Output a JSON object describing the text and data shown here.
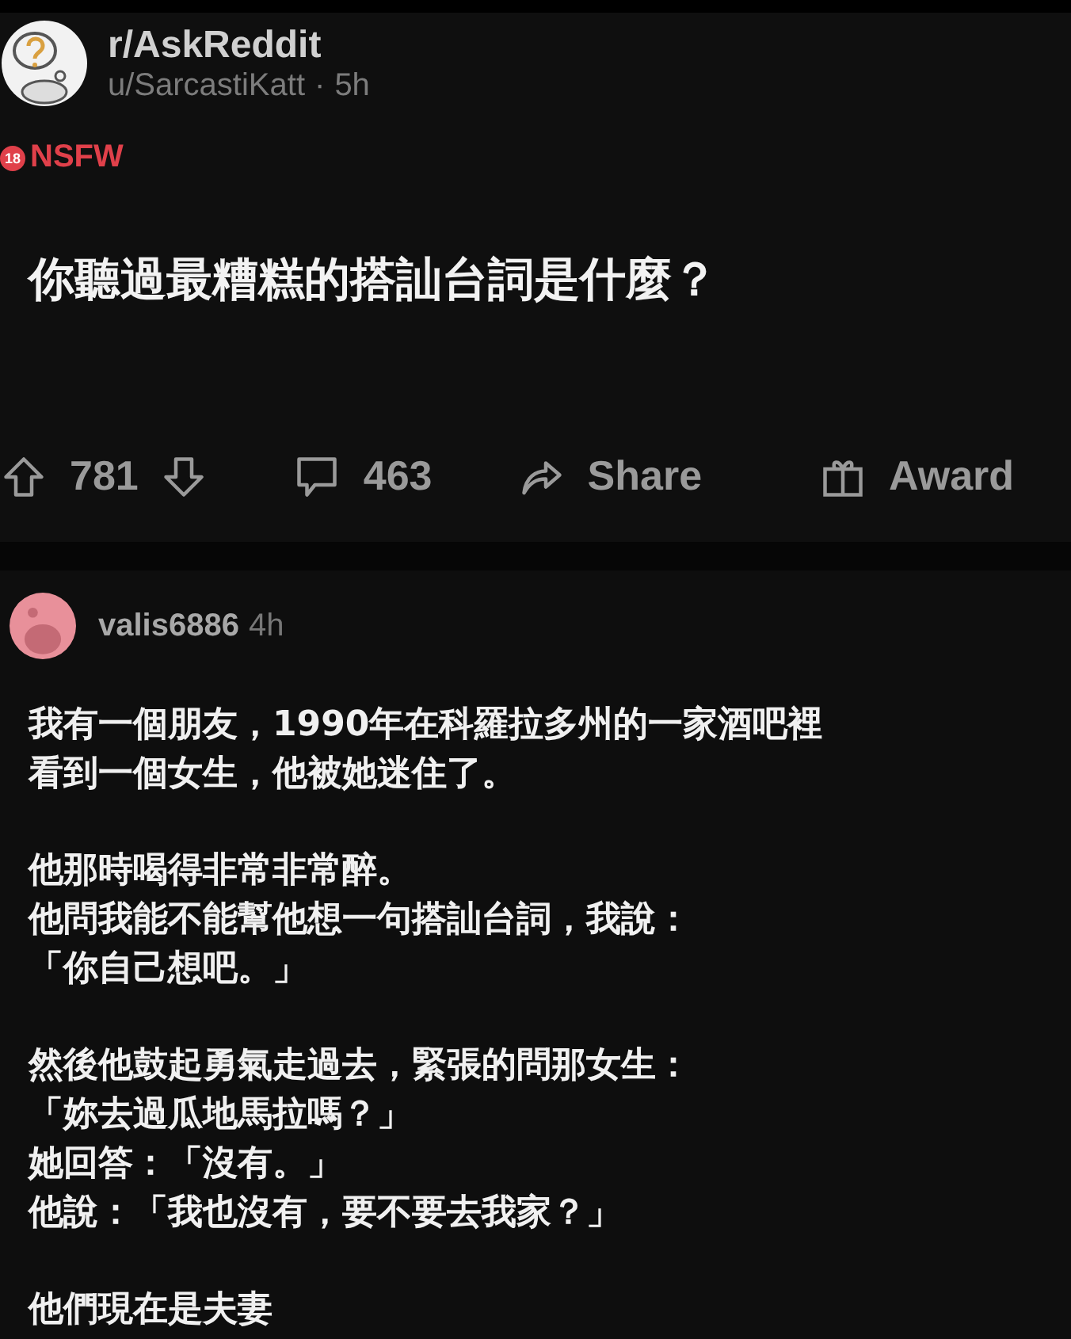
{
  "post": {
    "subreddit": "r/AskReddit",
    "author": "u/SarcastiKatt",
    "separator": "·",
    "time": "5h",
    "nsfw_badge": "18",
    "flair": "NSFW",
    "title": "你聽過最糟糕的搭訕台詞是什麼？"
  },
  "actions": {
    "upvotes": "781",
    "comments": "463",
    "share": "Share",
    "award": "Award"
  },
  "comment": {
    "author": "valis6886",
    "time": "4h",
    "paragraphs": [
      [
        "我有一個朋友，1990年在科羅拉多州的一家酒吧裡",
        "看到一個女生，他被她迷住了。"
      ],
      [
        "他那時喝得非常非常醉。",
        "他問我能不能幫他想一句搭訕台詞，我說：",
        "「你自己想吧。」"
      ],
      [
        "然後他鼓起勇氣走過去，緊張的問那女生：",
        "「妳去過瓜地馬拉嗎？」",
        "她回答：「沒有。」",
        "他說：「我也沒有，要不要去我家？」"
      ],
      [
        "他們現在是夫妻"
      ]
    ]
  }
}
